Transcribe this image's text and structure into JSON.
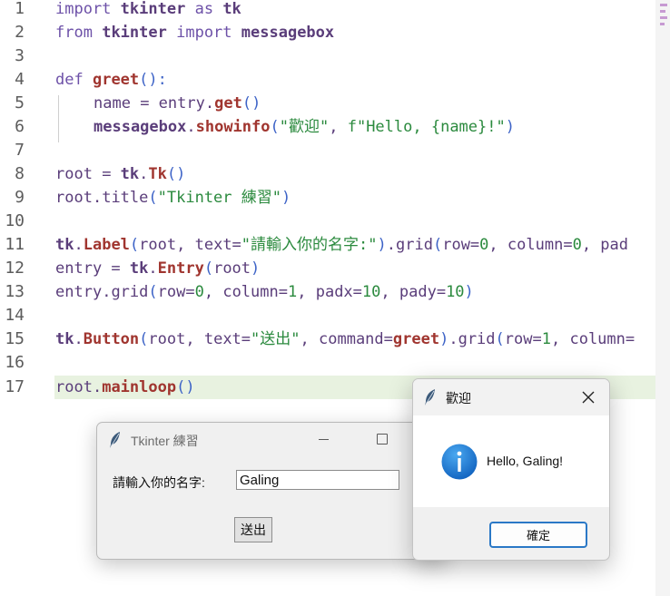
{
  "editor": {
    "lines": [
      {
        "n": "1"
      },
      {
        "n": "2"
      },
      {
        "n": "3"
      },
      {
        "n": "4"
      },
      {
        "n": "5"
      },
      {
        "n": "6"
      },
      {
        "n": "7"
      },
      {
        "n": "8"
      },
      {
        "n": "9"
      },
      {
        "n": "10"
      },
      {
        "n": "11"
      },
      {
        "n": "12"
      },
      {
        "n": "13"
      },
      {
        "n": "14"
      },
      {
        "n": "15"
      },
      {
        "n": "16"
      },
      {
        "n": "17"
      }
    ],
    "highlight_color": "#e8f2e0",
    "tokens": {
      "import": "import",
      "tkinter": "tkinter",
      "as": "as",
      "tk": "tk",
      "from": "from",
      "messagebox": "messagebox",
      "def": "def",
      "greet": "greet",
      "paren_colon": "():",
      "name": "name",
      "eq": " = ",
      "entry": "entry",
      "dot": ".",
      "get": "get",
      "parens": "()",
      "showinfo": "showinfo",
      "open_paren": "(",
      "close_paren": ")",
      "str_welcome": "\"歡迎\"",
      "comma": ", ",
      "fstr_start": "f\"Hello, ",
      "fstr_var": "{name}",
      "fstr_end": "!\"",
      "root": "root",
      "Tk": "Tk",
      "title": "title",
      "str_title": "\"Tkinter 練習\"",
      "Label": "Label",
      "text_kw": "text=",
      "str_label": "\"請輸入你的名字:\"",
      "grid": "grid",
      "row_kw": "row=",
      "col_kw": "column=",
      "zero": "0",
      "one": "1",
      "pad_trunc": "pad",
      "Entry": "Entry",
      "padx_kw": "padx=",
      "pady_kw": "pady=",
      "ten": "10",
      "Button": "Button",
      "str_button": "\"送出\"",
      "command_kw": "command=",
      "col_trunc": "column=",
      "mainloop": "mainloop"
    }
  },
  "tk_window": {
    "title": "Tkinter 練習",
    "label": "請輸入你的名字:",
    "entry_value": "Galing",
    "button_label": "送出"
  },
  "messagebox": {
    "title": "歡迎",
    "message": "Hello, Galing!",
    "ok_label": "確定",
    "icon": "info-icon",
    "accent": "#1e78d2"
  }
}
